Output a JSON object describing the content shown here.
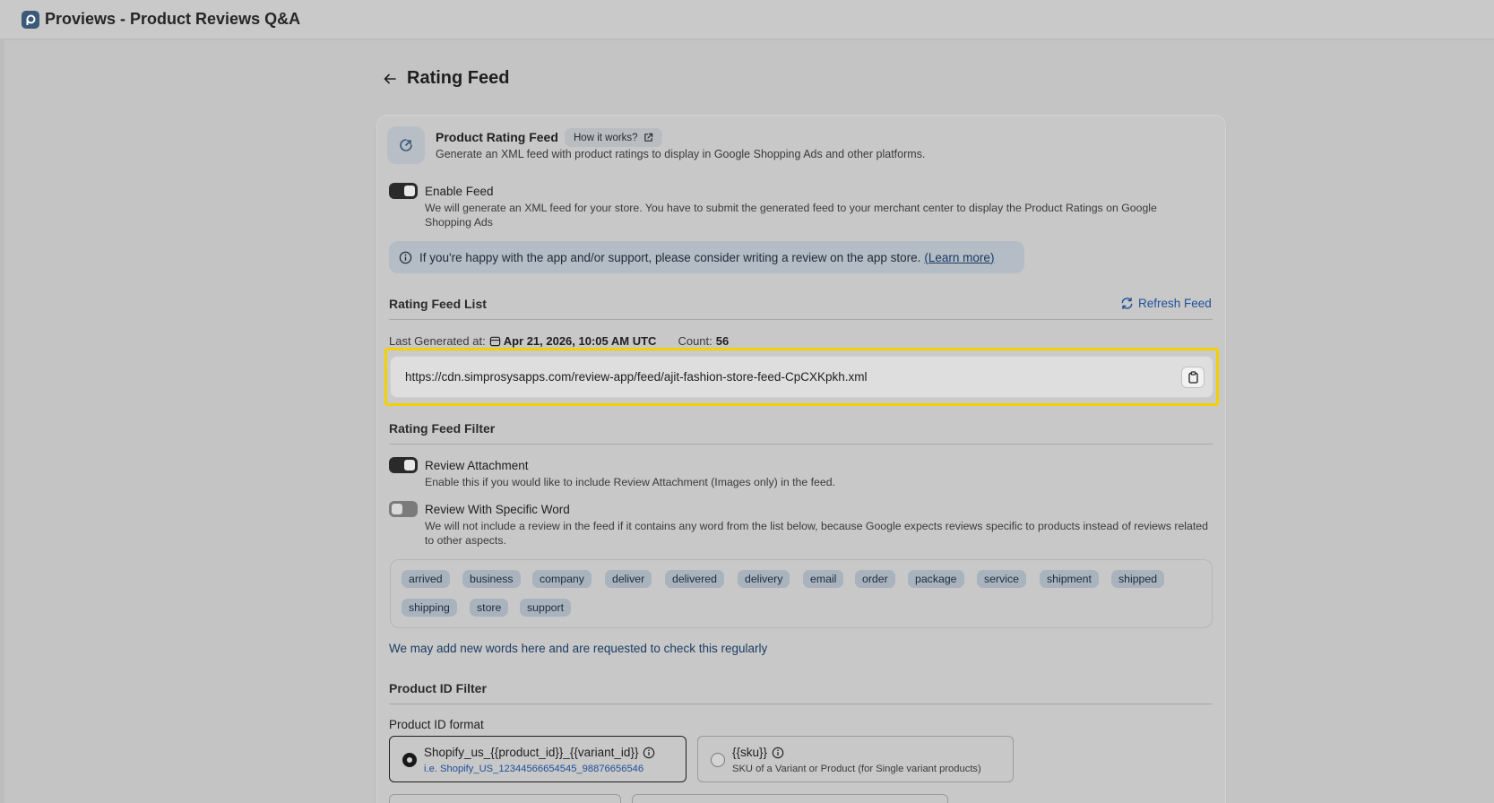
{
  "app": {
    "title": "Proviews - Product Reviews Q&A"
  },
  "page": {
    "title": "Rating Feed"
  },
  "feed_card": {
    "title": "Product Rating Feed",
    "how_label": "How it works?",
    "description": "Generate an XML feed with product ratings to display in Google Shopping Ads and other platforms."
  },
  "enable_feed": {
    "label": "Enable Feed",
    "enabled": true,
    "description": "We will generate an XML feed for your store. You have to submit the generated feed to your merchant center to display the Product Ratings on Google Shopping Ads"
  },
  "banner": {
    "text": "If you're happy with the app and/or support, please consider writing a review on the app store.",
    "link": "(Learn more)"
  },
  "feed_list": {
    "title": "Rating Feed List",
    "refresh_label": "Refresh Feed",
    "last_generated_label": "Last Generated at:",
    "last_generated_value": "Apr 21, 2026, 10:05 AM UTC",
    "count_label": "Count:",
    "count_value": "56",
    "url": "https://cdn.simprosysapps.com/review-app/feed/ajit-fashion-store-feed-CpCXKpkh.xml"
  },
  "feed_filter": {
    "title": "Rating Feed Filter",
    "attachment": {
      "label": "Review Attachment",
      "enabled": true,
      "description": "Enable this if you would like to include Review Attachment (Images only) in the feed."
    },
    "specific_word": {
      "label": "Review With Specific Word",
      "enabled": false,
      "description": "We will not include a review in the feed if it contains any word from the list below, because Google expects reviews specific to products instead of reviews related to other aspects."
    },
    "words": [
      "arrived",
      "business",
      "company",
      "deliver",
      "delivered",
      "delivery",
      "email",
      "order",
      "package",
      "service",
      "shipment",
      "shipped",
      "shipping",
      "store",
      "support"
    ],
    "note": "We may add new words here and are requested to check this regularly"
  },
  "product_id_filter": {
    "title": "Product ID Filter",
    "format_label": "Product ID format",
    "options": [
      {
        "title": "Shopify_us_{{product_id}}_{{variant_id}}",
        "sub": "i.e. Shopify_US_12344566654545_98876656546",
        "selected": true
      },
      {
        "title": "{{sku}}",
        "sub": "SKU of a Variant or Product (for Single variant products)",
        "selected": false
      }
    ]
  },
  "colors": {
    "accent": "#1e4f9a",
    "highlight": "#f5d000",
    "banner_bg": "#b4bcc6"
  }
}
